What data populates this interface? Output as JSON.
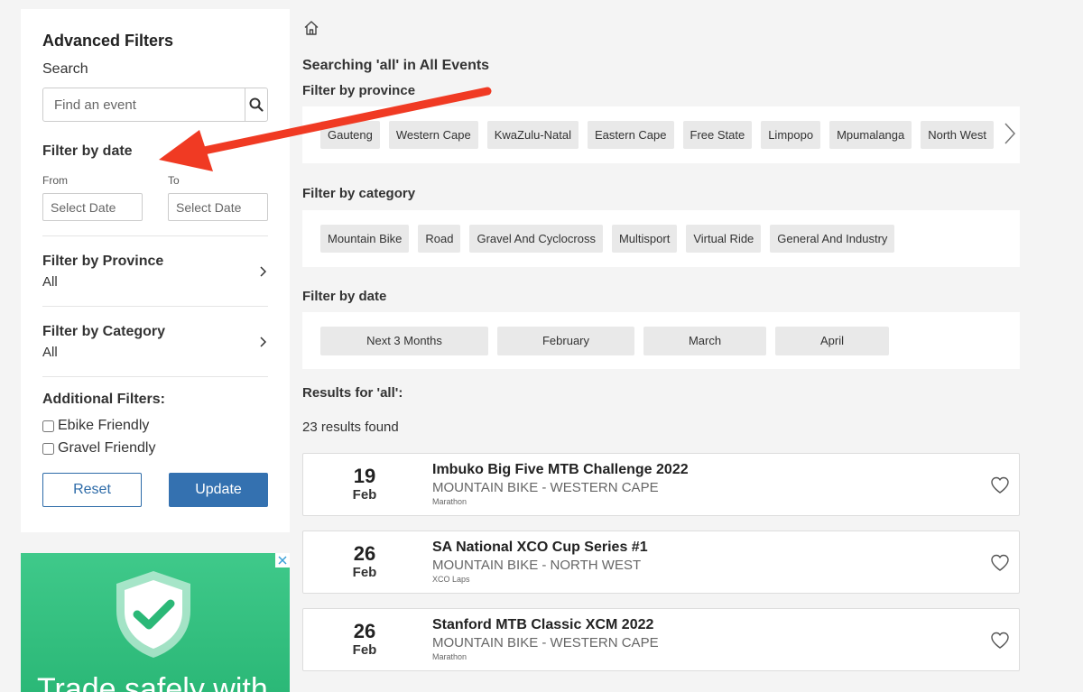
{
  "sidebar": {
    "title": "Advanced Filters",
    "search_label": "Search",
    "search_placeholder": "Find an event",
    "date_title": "Filter by date",
    "from_label": "From",
    "to_label": "To",
    "from_placeholder": "Select Date",
    "to_placeholder": "Select Date",
    "province_title": "Filter by Province",
    "province_value": "All",
    "category_title": "Filter by Category",
    "category_value": "All",
    "additional_title": "Additional Filters:",
    "ebike_label": "Ebike Friendly",
    "gravel_label": "Gravel Friendly",
    "reset_label": "Reset",
    "update_label": "Update"
  },
  "ad": {
    "text": "Trade safely with",
    "accent": "#3fc98a"
  },
  "main": {
    "heading": "Searching 'all' in All Events",
    "province_title": "Filter by province",
    "provinces": [
      "Gauteng",
      "Western Cape",
      "KwaZulu-Natal",
      "Eastern Cape",
      "Free State",
      "Limpopo",
      "Mpumalanga",
      "North West"
    ],
    "category_title": "Filter by category",
    "categories": [
      "Mountain Bike",
      "Road",
      "Gravel And Cyclocross",
      "Multisport",
      "Virtual Ride",
      "General And Industry"
    ],
    "date_title": "Filter by date",
    "dates": [
      "Next 3 Months",
      "February",
      "March",
      "April"
    ],
    "results_title": "Results for 'all':",
    "results_count": "23 results found"
  },
  "events": [
    {
      "day": "19",
      "month": "Feb",
      "title": "Imbuko Big Five MTB Challenge 2022",
      "category": "MOUNTAIN BIKE - WESTERN CAPE",
      "sub": "Marathon"
    },
    {
      "day": "26",
      "month": "Feb",
      "title": "SA National XCO Cup Series #1",
      "category": "MOUNTAIN BIKE - NORTH WEST",
      "sub": "XCO Laps"
    },
    {
      "day": "26",
      "month": "Feb",
      "title": "Stanford MTB Classic XCM 2022",
      "category": "MOUNTAIN BIKE - WESTERN CAPE",
      "sub": "Marathon"
    }
  ],
  "icons": {
    "home": "home-icon",
    "search": "search-icon",
    "heart": "heart-icon",
    "chevron": "chevron-right-icon"
  },
  "colors": {
    "primary": "#3471b0",
    "annotation_arrow": "#f03a23"
  }
}
